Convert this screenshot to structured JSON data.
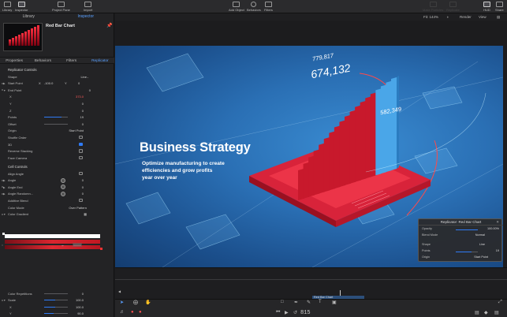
{
  "toolbar": {
    "library": "Library",
    "inspector": "Inspector",
    "project_pane": "Project Pane",
    "import": "Import",
    "add_object": "Add Object",
    "behaviors": "Behaviors",
    "filters": "Filters",
    "make_particles": "Make Particles",
    "replicate": "Replicate",
    "hud": "HUD",
    "share": "Share"
  },
  "left_panel": {
    "tabs": [
      "Library",
      "Inspector"
    ],
    "object_name": "Red Bar Chart",
    "inspector_tabs": [
      "Properties",
      "Behaviors",
      "Filters",
      "Replicator"
    ],
    "replicator_controls": {
      "title": "Replicator Controls",
      "shape_label": "Shape",
      "shape_value": "Line",
      "start_point_label": "Start Point",
      "start_point_x_label": "X",
      "start_point_x": "-100.0",
      "start_point_y_label": "Y",
      "start_point_y": "0",
      "end_point_label": "End Point",
      "end_point_val": "0",
      "x_label": "X",
      "x_val": "373.0",
      "y_label": "Y",
      "y_val": "0",
      "z_label": "Z",
      "z_val": "0",
      "points_label": "Points",
      "points_val": "19",
      "offset_label": "Offset",
      "offset_val": "0",
      "origin_label": "Origin",
      "origin_val": "Start Point",
      "shuffle_label": "Shuffle Order",
      "three_d_label": "3D",
      "reverse_label": "Reverse Stacking",
      "face_camera_label": "Face Camera"
    },
    "cell_controls": {
      "title": "Cell Controls",
      "align_angle": "Align Angle",
      "angle": "Angle",
      "angle_val": "0",
      "angle_end": "Angle End",
      "angle_end_val": "0",
      "angle_random": "Angle Randomn...",
      "angle_random_val": "0",
      "additive_blend": "Additive Blend",
      "color_mode": "Color Mode",
      "color_mode_val": "Over Pattern",
      "color_gradient": "Color Gradient",
      "color_repetitions": "Color Repetitions",
      "color_repetitions_val": "0",
      "scale": "Scale",
      "scale_val": "100.0",
      "scale_x": "X",
      "scale_x_val": "100.0",
      "scale_y": "Y",
      "scale_y_val": "90.0"
    }
  },
  "viewer": {
    "fit": "Fit: 144%",
    "render": "Render",
    "view": "View"
  },
  "canvas": {
    "headline": "Business Strategy",
    "sub_lines": [
      "Optimize manufacturing to create",
      "efficiencies and grow profits",
      "year over year"
    ],
    "num_1": "779,817",
    "num_2": "674,132",
    "num_3": "582,349"
  },
  "hud": {
    "title": "Replicator: Red Bar Chart",
    "opacity_label": "Opacity",
    "opacity_val": "100.00%",
    "blend_label": "Blend Mode",
    "blend_val": "Normal",
    "shape_label": "Shape",
    "shape_val": "Line",
    "points_label": "Points",
    "points_val": "19",
    "origin_label": "Origin",
    "origin_val": "Start Point"
  },
  "timeline": {
    "clip_label": "Red Bar Chart",
    "timecode": "815"
  }
}
